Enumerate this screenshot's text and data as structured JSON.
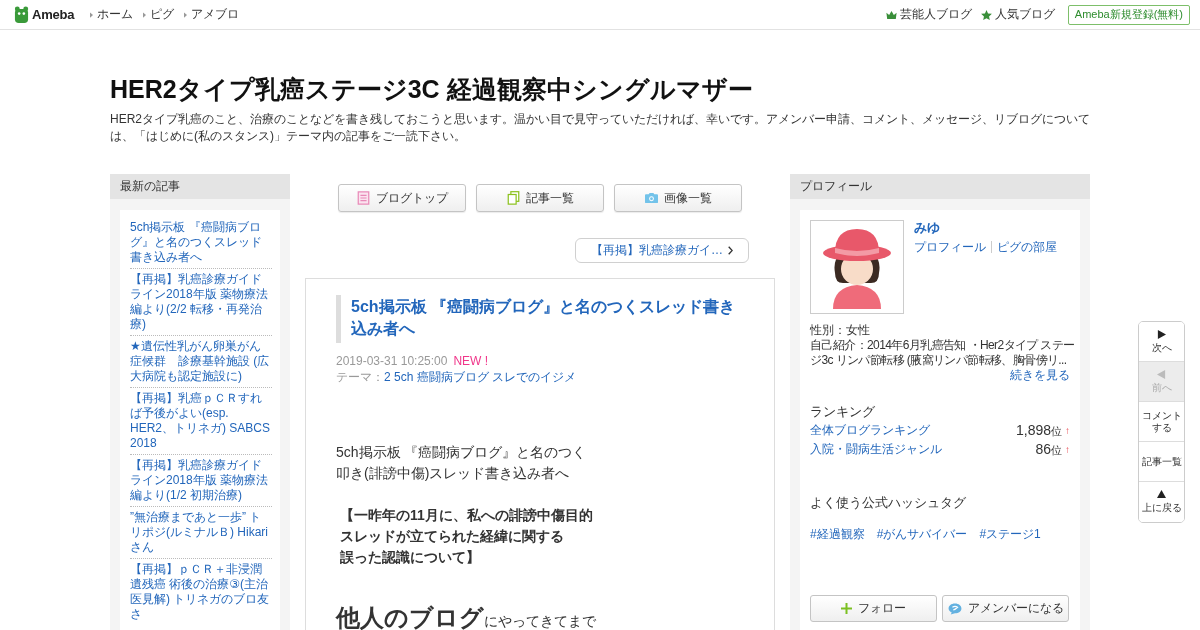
{
  "header": {
    "logo": "Ameba",
    "nav": [
      "ホーム",
      "ピグ",
      "アメブロ"
    ],
    "links": [
      {
        "label": "芸能人ブログ",
        "kind": "crown"
      },
      {
        "label": "人気ブログ",
        "kind": "star"
      }
    ],
    "signup": "Ameba新規登録(無料)"
  },
  "blog": {
    "title": "HER2タイプ乳癌ステージ3C 経過観察中シングルマザー",
    "description": "HER2タイプ乳癌のこと、治療のことなどを書き残しておこうと思います。温かい目で見守っていただければ、幸いです。アメンバー申請、コメント、メッセージ、リブログについては、「はじめに(私のスタンス)」テーマ内の記事をご一読下さい。"
  },
  "latest": {
    "heading": "最新の記事",
    "items": [
      "5ch掲示板 『癌闘病ブログ』と名のつくスレッド書き込み者へ",
      "【再掲】乳癌診療ガイドライン2018年版 薬物療法編より(2/2 転移・再発治療)",
      "★遺伝性乳がん卵巣がん症候群　診療基幹施設 (広大病院も認定施設に)",
      "【再掲】乳癌ｐＣＲすれば予後がよい(esp. HER2、トリネガ) SABCS 2018",
      "【再掲】乳癌診療ガイドライン2018年版 薬物療法編より(1/2 初期治療)",
      "”無治療まであと一歩” トリポジ(ルミナルＢ) Hikariさん",
      "【再掲】ｐＣＲ＋非浸潤遺残癌 術後の治療③(主治医見解) トリネガのブロ友さ"
    ]
  },
  "blog_nav": [
    {
      "label": "ブログトップ",
      "kind": "top"
    },
    {
      "label": "記事一覧",
      "kind": "list"
    },
    {
      "label": "画像一覧",
      "kind": "images"
    }
  ],
  "next_article": "【再掲】乳癌診療ガイ…",
  "article": {
    "title": "5ch掲示板 『癌闘病ブログ』と名のつくスレッド書き込み者へ",
    "date": "2019-03-31 10:25:00",
    "badge": "NEW !",
    "theme_label": "テーマ：",
    "theme": "2 5ch 癌闘病ブログ スレでのイジメ",
    "body": [
      {
        "kind": "plain",
        "lines": [
          "5ch掲示板 『癌闘病ブログ』と名のつく",
          "叩き(誹謗中傷)スレッド書き込み者へ"
        ]
      },
      {
        "kind": "bold",
        "lines": [
          "【一昨年の11月に、私への誹謗中傷目的",
          "スレッドが立てられた経緯に関する",
          "誤った認識について】"
        ]
      },
      {
        "kind": "large",
        "big": "他人のブログ",
        "rest": "にやってきてまで"
      }
    ]
  },
  "profile": {
    "heading": "プロフィール",
    "name": "みゆ",
    "links": [
      "プロフィール",
      "ピグの部屋"
    ],
    "gender": "性別：女性",
    "intro": "自己紹介：2014年6月乳癌告知 ・Her2タイプ ステージ3c リンパ節転移 (腋窩リンパ節転移、胸骨傍リ...",
    "more": "続きを見る",
    "ranking_heading": "ランキング",
    "rankings": [
      {
        "label": "全体ブログランキング",
        "rank": "1,898",
        "unit": "位",
        "trend": "↑"
      },
      {
        "label": "入院・闘病生活ジャンル",
        "rank": "86",
        "unit": "位",
        "trend": "↑"
      }
    ],
    "hashtag_heading": "よく使う公式ハッシュタグ",
    "hashtags": [
      "#経過観察",
      "#がんサバイバー",
      "#ステージ1"
    ],
    "buttons": [
      {
        "label": "フォロー",
        "kind": "follow"
      },
      {
        "label": "アメンバーになる",
        "kind": "member"
      }
    ]
  },
  "side_nav": [
    {
      "label": "次へ",
      "kind": "next",
      "disabled": false
    },
    {
      "label": "前へ",
      "kind": "prev",
      "disabled": true
    },
    {
      "label": "コメントする",
      "kind": "comment",
      "disabled": false
    },
    {
      "label": "記事一覧",
      "kind": "list",
      "disabled": false
    },
    {
      "label": "上に戻る",
      "kind": "top",
      "disabled": false
    }
  ]
}
